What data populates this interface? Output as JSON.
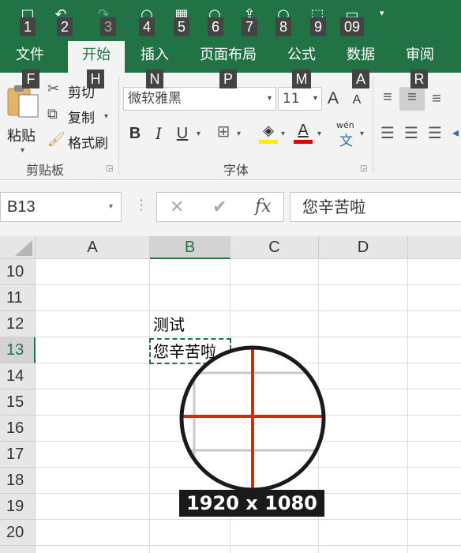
{
  "quick_access": {
    "buttons": [
      {
        "icon": "save-icon",
        "glyph": "□",
        "keytip": "1"
      },
      {
        "icon": "undo-icon",
        "glyph": "↶",
        "keytip": "2"
      },
      {
        "icon": "redo-icon",
        "glyph": "↷",
        "keytip": "3"
      },
      {
        "icon": "circle-icon",
        "glyph": "○",
        "keytip": "4"
      },
      {
        "icon": "grid-icon",
        "glyph": "▦",
        "keytip": "5"
      },
      {
        "icon": "circle-icon",
        "glyph": "○",
        "keytip": "6"
      },
      {
        "icon": "share-icon",
        "glyph": "⇪",
        "keytip": "7"
      },
      {
        "icon": "circle-icon",
        "glyph": "○",
        "keytip": "8"
      },
      {
        "icon": "dotted-box-icon",
        "glyph": "⬚",
        "keytip": "9"
      },
      {
        "icon": "screen-icon",
        "glyph": "▭",
        "keytip": "09"
      }
    ],
    "more_glyph": "▾"
  },
  "tabs": [
    {
      "label": "文件",
      "keytip": "F"
    },
    {
      "label": "开始",
      "keytip": "H",
      "active": true
    },
    {
      "label": "插入",
      "keytip": "N"
    },
    {
      "label": "页面布局",
      "keytip": "P"
    },
    {
      "label": "公式",
      "keytip": "M"
    },
    {
      "label": "数据",
      "keytip": "A"
    },
    {
      "label": "审阅",
      "keytip": "R"
    }
  ],
  "clipboard": {
    "paste_label": "粘贴",
    "cut_label": "剪切",
    "copy_label": "复制",
    "format_painter_label": "格式刷",
    "group_label": "剪贴板"
  },
  "font": {
    "font_name": "微软雅黑",
    "font_size": "11",
    "bold": "B",
    "italic": "I",
    "underline": "U",
    "grow": "A",
    "shrink": "A",
    "phonetic_top": "wén",
    "phonetic_bottom": "文",
    "font_color_letter": "A",
    "group_label": "字体",
    "highlight_color": "#ffeb00",
    "font_color": "#e00000"
  },
  "formula_bar": {
    "name_box": "B13",
    "cancel": "✕",
    "enter": "✔",
    "fx": "fx",
    "content": "您辛苦啦"
  },
  "grid": {
    "columns": [
      "A",
      "B",
      "C",
      "D"
    ],
    "selected_column": "B",
    "rows": [
      "10",
      "11",
      "12",
      "13",
      "14",
      "15",
      "16",
      "17",
      "18",
      "19",
      "20"
    ],
    "selected_row": "13",
    "cells": {
      "B12": "测试",
      "B13": "您辛苦啦"
    }
  },
  "overlay": {
    "resolution": "1920 x 1080",
    "accent": "#d52b00"
  },
  "colors": {
    "excel_green": "#217346"
  }
}
